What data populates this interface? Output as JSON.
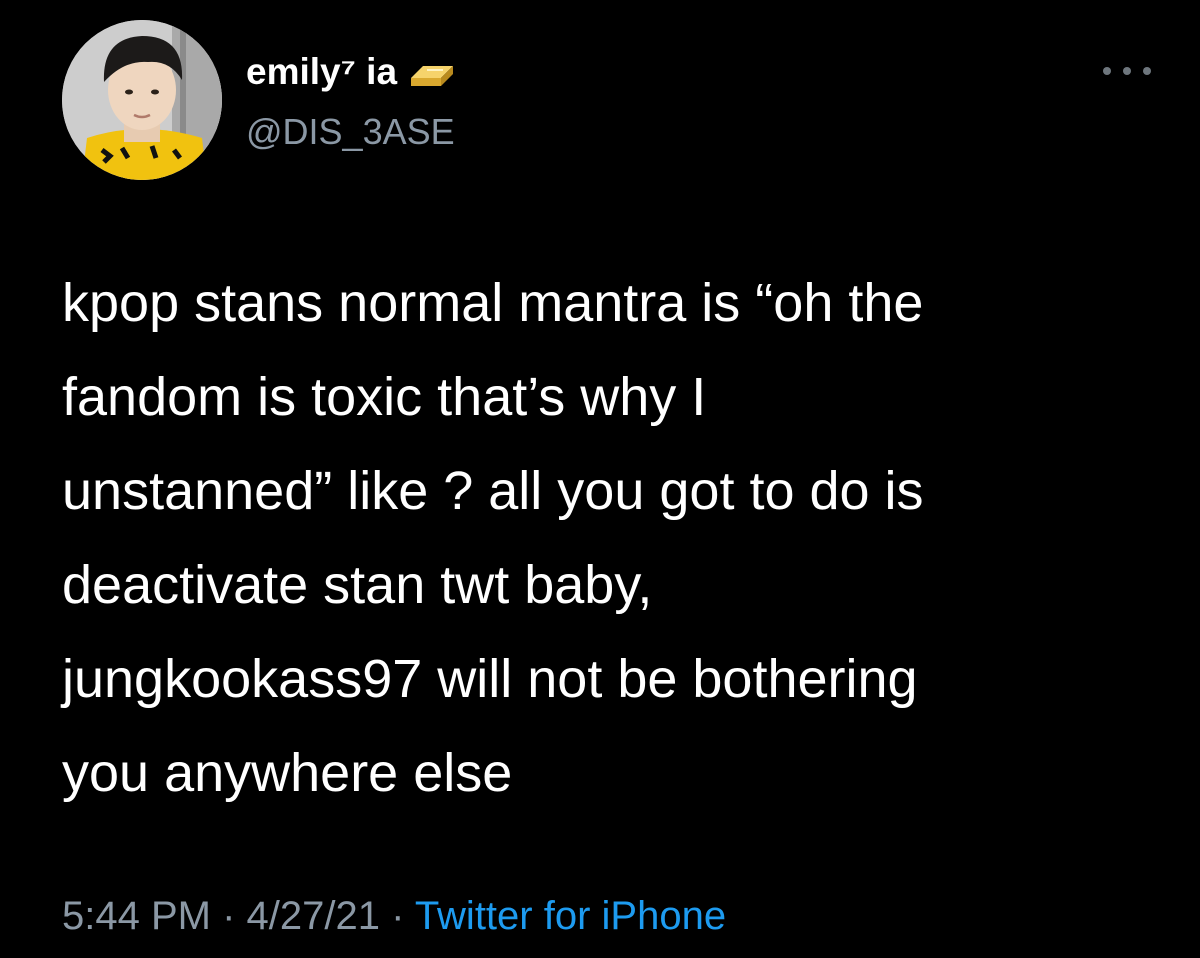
{
  "tweet": {
    "author": {
      "display_name": "emily⁷ ia",
      "badge_icon": "gold-bar-icon",
      "handle": "@DIS_3ASE",
      "avatar_icon": "profile-photo"
    },
    "more_icon": "more-options-icon",
    "text_lines": [
      "kpop stans normal mantra is “oh the",
      "fandom is toxic that’s why I",
      "unstanned” like ? all you got to do is",
      "deactivate stan twt baby,",
      "jungkookass97 will not be bothering",
      "you anywhere else"
    ],
    "meta": {
      "time": "5:44 PM",
      "separator": " · ",
      "date": "4/27/21",
      "source": "Twitter for iPhone"
    }
  },
  "colors": {
    "background": "#000000",
    "primary_text": "#ffffff",
    "secondary_text": "#8b98a5",
    "link": "#1d9bf0"
  }
}
